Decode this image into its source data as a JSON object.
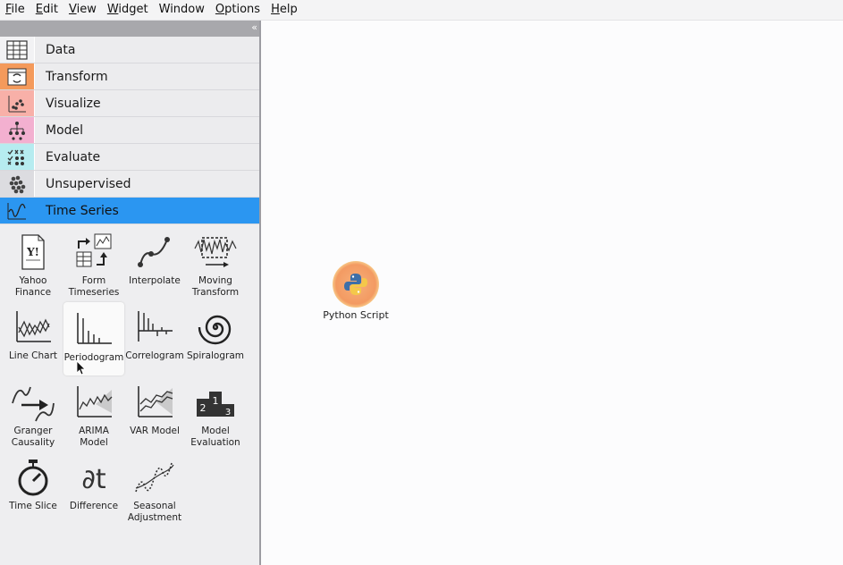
{
  "menubar": {
    "items": [
      {
        "label": "File",
        "u": "F",
        "rest": "ile"
      },
      {
        "label": "Edit",
        "u": "E",
        "rest": "dit"
      },
      {
        "label": "View",
        "u": "V",
        "rest": "iew"
      },
      {
        "label": "Widget",
        "u": "W",
        "rest": "idget"
      },
      {
        "label": "Window",
        "u": "",
        "rest": "Window"
      },
      {
        "label": "Options",
        "u": "O",
        "rest": "ptions"
      },
      {
        "label": "Help",
        "u": "H",
        "rest": "elp"
      }
    ]
  },
  "sidebar": {
    "collapse_glyph": "«",
    "categories": [
      {
        "label": "Data",
        "icon": "table-icon",
        "color": "#f2f2f4"
      },
      {
        "label": "Transform",
        "icon": "transform-icon",
        "color": "#f49a5b"
      },
      {
        "label": "Visualize",
        "icon": "scatter-icon",
        "color": "#f8b0a8"
      },
      {
        "label": "Model",
        "icon": "tree-icon",
        "color": "#f3b0d0"
      },
      {
        "label": "Evaluate",
        "icon": "evaluate-icon",
        "color": "#b6ecf0"
      },
      {
        "label": "Unsupervised",
        "icon": "clusters-icon",
        "color": "#dcdce0"
      },
      {
        "label": "Time Series",
        "icon": "timeseries-icon",
        "color": "#2b96f1"
      }
    ],
    "tools": [
      {
        "label1": "Yahoo",
        "label2": "Finance",
        "icon": "yahoo-finance-icon"
      },
      {
        "label1": "Form",
        "label2": "Timeseries",
        "icon": "form-timeseries-icon"
      },
      {
        "label1": "Interpolate",
        "label2": "",
        "icon": "interpolate-icon"
      },
      {
        "label1": "Moving",
        "label2": "Transform",
        "icon": "moving-transform-icon"
      },
      {
        "label1": "Line Chart",
        "label2": "",
        "icon": "line-chart-icon"
      },
      {
        "label1": "Periodogram",
        "label2": "",
        "icon": "periodogram-icon"
      },
      {
        "label1": "Correlogram",
        "label2": "",
        "icon": "correlogram-icon"
      },
      {
        "label1": "Spiralogram",
        "label2": "",
        "icon": "spiralogram-icon"
      },
      {
        "label1": "Granger",
        "label2": "Causality",
        "icon": "granger-causality-icon"
      },
      {
        "label1": "ARIMA",
        "label2": "Model",
        "icon": "arima-icon"
      },
      {
        "label1": "VAR Model",
        "label2": "",
        "icon": "var-model-icon"
      },
      {
        "label1": "Model",
        "label2": "Evaluation",
        "icon": "model-evaluation-icon"
      },
      {
        "label1": "Time Slice",
        "label2": "",
        "icon": "stopwatch-icon"
      },
      {
        "label1": "Difference",
        "label2": "",
        "icon": "difference-icon"
      },
      {
        "label1": "Seasonal",
        "label2": "Adjustment",
        "icon": "seasonal-adjustment-icon"
      }
    ]
  },
  "canvas": {
    "node": {
      "label": "Python Script",
      "icon": "python-icon"
    }
  }
}
